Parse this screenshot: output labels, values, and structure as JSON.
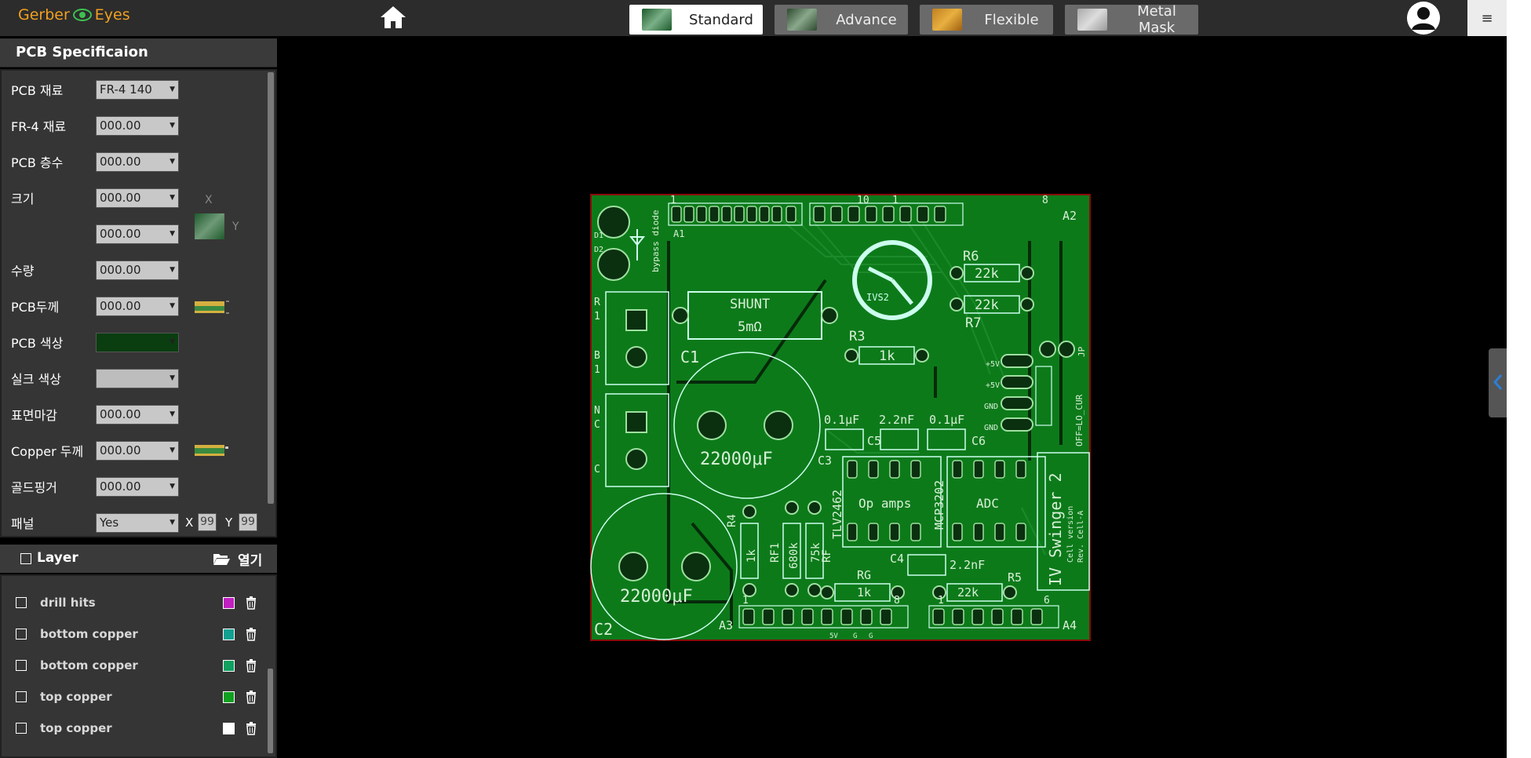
{
  "app": {
    "logo_left": "Gerber",
    "logo_right": "Eyes"
  },
  "header": {
    "tabs": [
      {
        "label": "Standard",
        "active": true
      },
      {
        "label": "Advance",
        "active": false
      },
      {
        "label": "Flexible",
        "active": false
      },
      {
        "label": "Metal Mask",
        "active": false
      }
    ],
    "menu_icon": "≡"
  },
  "spec": {
    "title": "PCB Specificaion",
    "rows": [
      {
        "label": "PCB 재료",
        "value": "FR-4 140"
      },
      {
        "label": "FR-4 재료",
        "value": "000.00"
      },
      {
        "label": "PCB 층수",
        "value": "000.00"
      },
      {
        "label": "크기",
        "value": "000.00",
        "value2": "000.00",
        "axis_x": "X",
        "axis_y": "Y"
      },
      {
        "label": "수량",
        "value": "000.00"
      },
      {
        "label": "PCB두께",
        "value": "000.00"
      },
      {
        "label": "PCB 색상",
        "value": ""
      },
      {
        "label": "실크 색상",
        "value": ""
      },
      {
        "label": "표면마감",
        "value": "000.00"
      },
      {
        "label": "Copper 두께",
        "value": "000.00"
      },
      {
        "label": "골드핑거",
        "value": "000.00"
      },
      {
        "label": "패널",
        "value": "Yes",
        "x_label": "X",
        "x_value": "99",
        "y_label": "Y",
        "y_value": "99"
      }
    ],
    "pcb_color": "#0a3d10"
  },
  "layers": {
    "title": "Layer",
    "open_label": "열기",
    "items": [
      {
        "name": "drill hits",
        "color": "#c020c0"
      },
      {
        "name": "bottom copper",
        "color": "#12a090"
      },
      {
        "name": "bottom copper",
        "color": "#10a060"
      },
      {
        "name": "top copper",
        "color": "#10a020"
      },
      {
        "name": "top copper",
        "color": "#ffffff"
      }
    ]
  },
  "pcb_board": {
    "title": "IV Swinger 2",
    "subtitle1": "Cell version",
    "subtitle2": "Rev. Cell-A",
    "labels": [
      "SHUNT",
      "5mΩ",
      "C1",
      "C2",
      "22000μF",
      "22000μF",
      "R6",
      "22k",
      "22k",
      "R7",
      "R3",
      "1k",
      "IVS2",
      "0.1μF",
      "2.2nF",
      "0.1μF",
      "C3",
      "C5",
      "C6",
      "Op amps",
      "ADC",
      "TLV2462",
      "MCP3202",
      "R4",
      "1k",
      "RF1",
      "680k",
      "75k",
      "RF",
      "RG",
      "1k",
      "C4",
      "2.2nF",
      "22k",
      "R5",
      "A1",
      "A2",
      "A3",
      "A4",
      "D1",
      "D2",
      "bypass diode",
      "+5V",
      "+5V",
      "GND",
      "GND",
      "OFF=LO_CUR",
      "JP",
      "1",
      "10",
      "1",
      "8",
      "1",
      "8",
      "1",
      "6",
      "5V",
      "G",
      "G",
      "R",
      "1",
      "B",
      "1",
      "N",
      "C",
      "C"
    ]
  }
}
